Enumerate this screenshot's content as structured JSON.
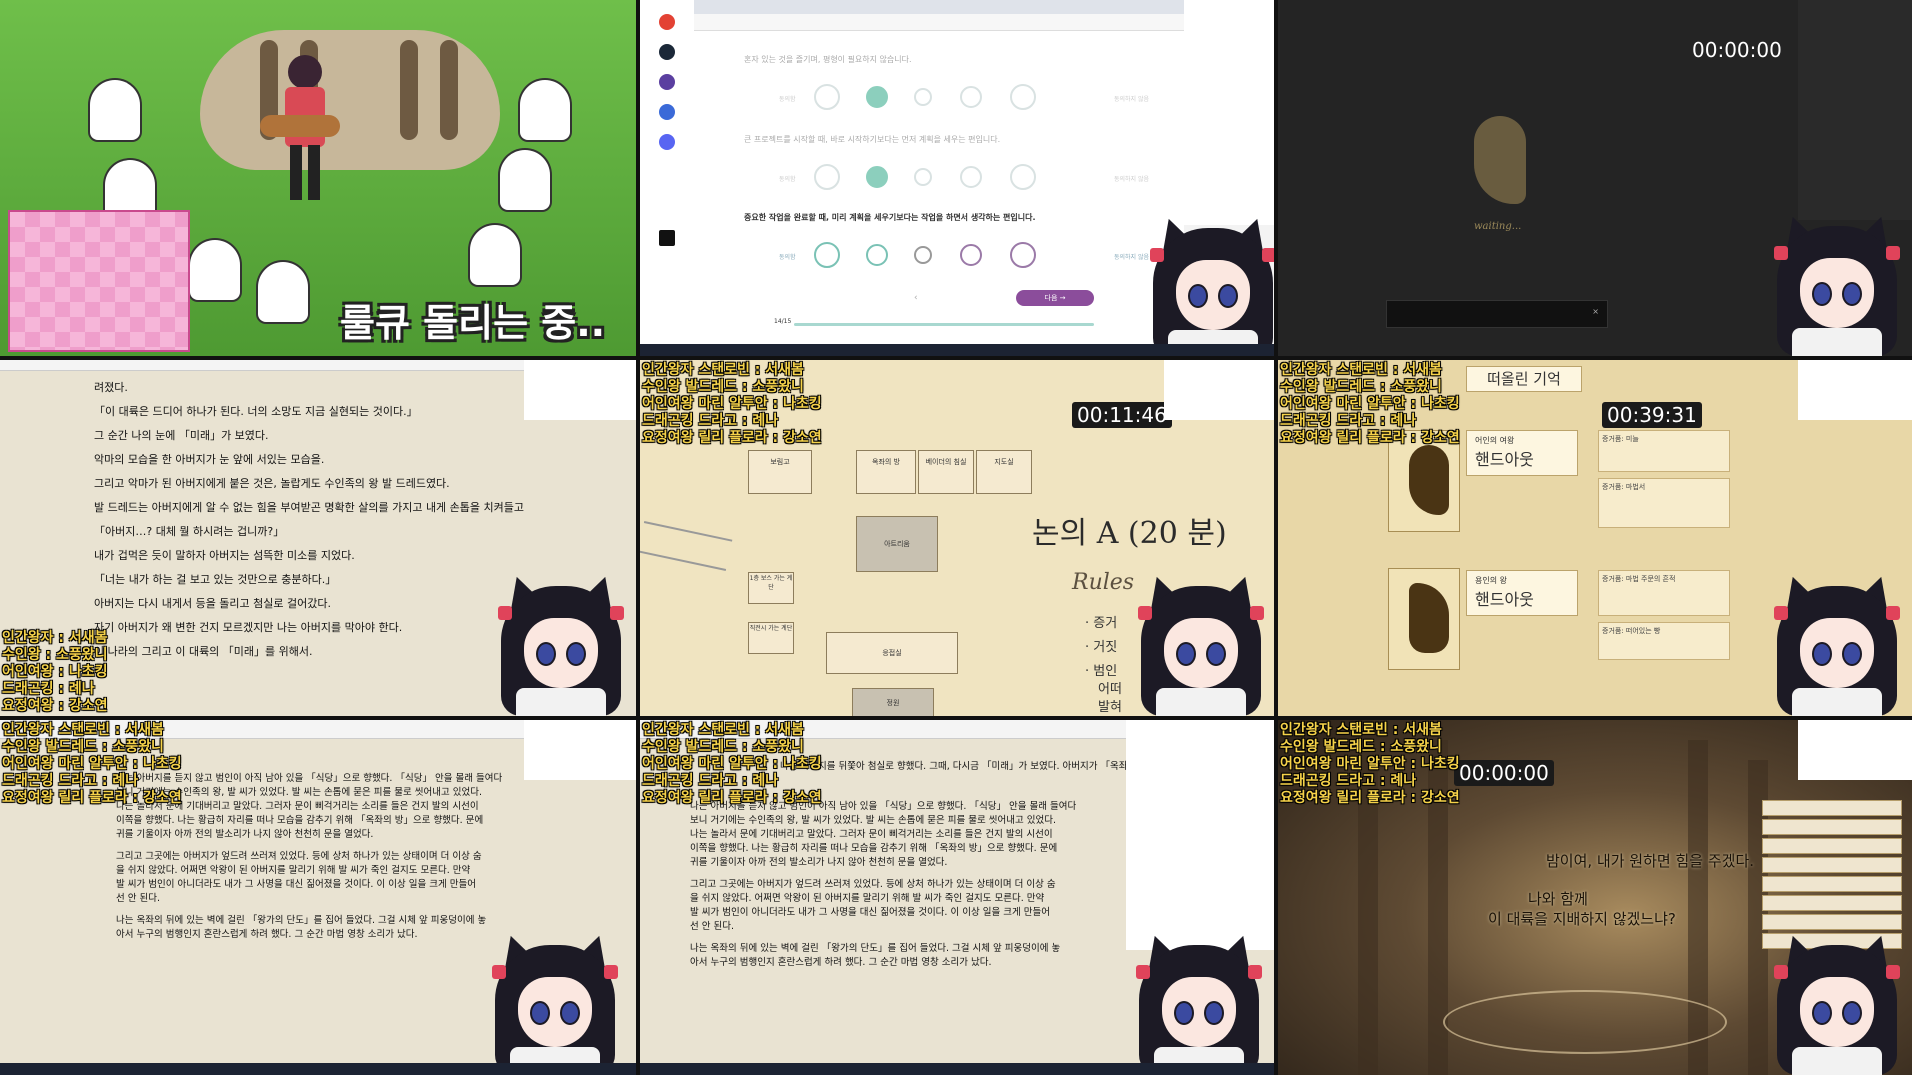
{
  "credits_short": [
    "인간왕자 스탠로빈 : 서새봄",
    "수인왕 발드레드 : 소풍왔니",
    "어인여왕 마린 알투안 : 나초킹",
    "드래곤킹 드라고 : 례나",
    "요정여왕 릴리 플로라 : 강소연"
  ],
  "credits_label": [
    "인간왕자 : 서새봄",
    "수인왕 : 소풍왔니",
    "어인여왕 : 나초킹",
    "드래곤킹 : 례나",
    "요정여왕 : 강소연"
  ],
  "cell1": {
    "caption": "룰큐 돌리는 중.."
  },
  "cell2": {
    "q1": "혼자 있는 것을 즐기며, 평형이 필요하지 않습니다.",
    "q2": "큰 프로젝트를 시작할 때, 바로 시작하기보다는 먼저 계획을 세우는 편입니다.",
    "q3": "중요한 작업을 완료할 때, 미리 계획을 세우기보다는 작업을 하면서 생각하는 편입니다.",
    "agree": "동의함",
    "disagree": "동의하지 않음",
    "next": "다음 →",
    "page": "14/15"
  },
  "cell3": {
    "timer": "00:00:00",
    "waiting": "waiting..."
  },
  "cell4": {
    "lines": [
      "려졌다.",
      "「이 대륙은 드디어 하나가 된다. 너의 소망도 지금 실현되는 것이다.」",
      "그 순간 나의 눈에 「미래」가 보였다.",
      "악마의 모습을 한 아버지가 눈 앞에 서있는 모습을.",
      "그리고 악마가 된 아버지에게 붙은 것은, 놀랍게도 수인족의 왕 발 드레드였다.",
      "발 드레드는 아버지에게 알 수 없는 힘을 부여받곤 명확한 살의를 가지고 내게 손톱을 치켜들고",
      "「아버지…? 대체 뭘 하시려는 겁니까?」",
      "내가 겁먹은 듯이 말하자 아버지는 섬뜩한 미소를 지었다.",
      "「너는 내가 하는 걸 보고 있는 것만으로 충분하다.」",
      "아버지는 다시 내게서 등을 돌리고 첨실로 걸어갔다.",
      "자기 아버지가 왜 변한 건지 모르겠지만 나는 아버지를 막아야 한다.",
      "이 나라의 그리고 이 대륙의 「미래」를 위해서."
    ]
  },
  "cell5": {
    "timer": "00:11:46",
    "title": "논의 A (20 분)",
    "rules": "Rules",
    "bullets": [
      "· 증거",
      "· 거짓",
      "· 범인",
      "어떠",
      "발혀"
    ],
    "rooms": [
      "보림고",
      "옥좌의 방",
      "베이더의 침실",
      "지도실",
      "아트리움",
      "1층 보스 가는 계단",
      "직전시 가는 계단",
      "응접실",
      "정원"
    ]
  },
  "cell6": {
    "timer": "00:39:31",
    "header": "떠올린 기억",
    "cards": [
      {
        "sub": "어인의 여왕",
        "name": "핸드아웃"
      },
      {
        "sub": "용인의 왕",
        "name": "핸드아웃"
      }
    ],
    "notes": [
      "증거품: 미늘",
      "증거품: 마법서",
      "증거품: 마법 주문의 흔적",
      "증거품: 떠어있는 빵"
    ]
  },
  "doc_lines": [
    "나는 아버지를 뒤쫓아 첨실로 향했다. 그때, 다시금 「미래」가 보였다. 아버지가 「옥좌의",
    "나는 아버지를 듣지 않고 범인이 아직 남아 있을 「식당」으로 향했다. 「식당」 안을 몰래 들여다",
    "보니 거기에는 수인족의 왕, 발 씨가 있었다. 발 씨는 손톱에 묻은 피를 물로 씻어내고 있었다.",
    "나는 놀라서 문에 기대버리고 말았다. 그러자 문이 삐걱거리는 소리를 들은 건지 발의 시선이",
    "이쪽을 향했다. 나는 황급히 자리를 떠나 모습을 감추기 위해 「옥좌의 방」으로 향했다. 문에",
    "귀를 기울이자 아까 전의 발소리가 나지 않아 천천히 문을 열었다.",
    "그리고 그곳에는 아버지가 엎드려 쓰러져 있었다. 등에 상처 하나가 있는 상태이며 더 이상 숨",
    "을 쉬지 않았다. 어쩌면 악왕이 된 아버지를 말리기 위해 발 씨가 죽인 걸지도 모른다. 만약",
    "발 씨가 범인이 아니더라도 내가 그 사명을 대신 짊어졌을 것이다. 이 이상 일을 크게 만들어",
    "선 안 된다.",
    "나는 옥좌의 뒤에 있는 벽에 걸린 「왕가의 단도」를 집어 들었다. 그걸 시체 앞 피웅덩이에 놓",
    "아서 누구의 범행인지 혼란스럽게 하려 했다. 그 순간 마법 영창 소리가 났다."
  ],
  "cell9": {
    "timer": "00:00:00",
    "line1": "밤이여, 내가 원하면 힘을 주겠다.",
    "line2": "나와 함께",
    "line3": "이 대륙을 지배하지 않겠느냐?"
  }
}
